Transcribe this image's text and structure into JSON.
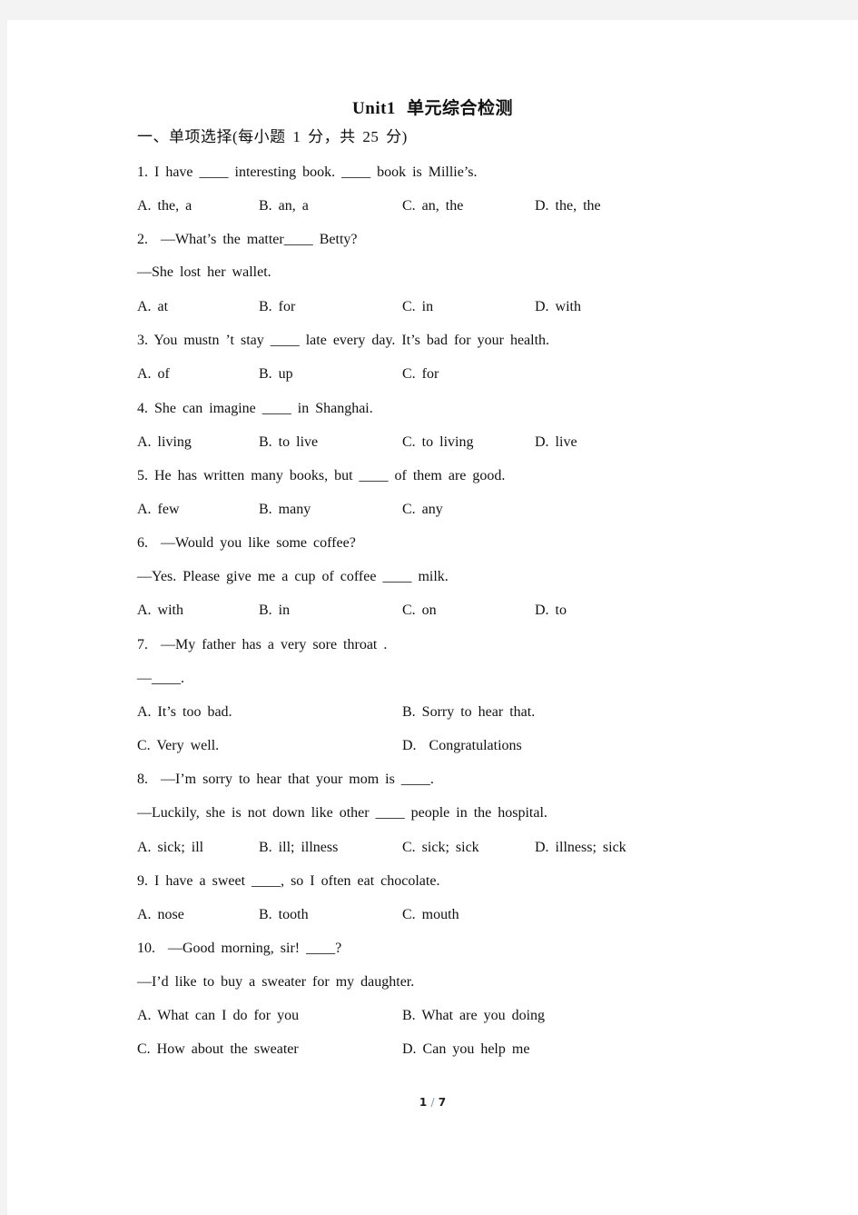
{
  "document": {
    "title_en": "Unit1",
    "title_cn": "单元综合检测",
    "section_heading": "一、单项选择(每小题 1 分，共 25 分)",
    "questions": [
      {
        "lines": [
          "1. I have ____ interesting book. ____ book is Millie’s."
        ],
        "options": [
          "A. the, a",
          "B. an, a",
          "C. an, the",
          "D. the, the"
        ]
      },
      {
        "lines": [
          "2.  —What’s the matter____ Betty?",
          "—She lost her wallet."
        ],
        "options": [
          "A. at",
          "B. for",
          "C. in",
          "D. with"
        ]
      },
      {
        "lines": [
          "3. You mustn ’t stay ____ late every day. It’s bad for your health."
        ],
        "options": [
          "A. of",
          "B. up",
          "C. for"
        ]
      },
      {
        "lines": [
          "4. She can imagine ____ in Shanghai."
        ],
        "options": [
          "A. living",
          "B. to live",
          "C. to living",
          "D. live"
        ]
      },
      {
        "lines": [
          "5. He has written many books, but ____ of them are good."
        ],
        "options": [
          "A. few",
          "B. many",
          "C. any"
        ]
      },
      {
        "lines": [
          "6.  —Would you like some coffee?",
          "—Yes. Please give me a cup of coffee ____ milk."
        ],
        "options": [
          "A. with",
          "B. in",
          "C. on",
          "D. to"
        ]
      },
      {
        "lines": [
          "7.  —My father has a very sore throat .",
          "—____."
        ],
        "options": [
          "A. It’s too bad.",
          "B. Sorry to hear that.",
          "C. Very well.",
          "D.  Congratulations"
        ]
      },
      {
        "lines": [
          "8.  —I’m sorry to hear that your mom is ____.",
          "—Luckily, she is not down like other ____ people in the hospital."
        ],
        "options": [
          "A. sick; ill",
          "B. ill; illness",
          "C. sick; sick",
          "D. illness; sick"
        ]
      },
      {
        "lines": [
          "9. I have a sweet ____, so I often eat chocolate."
        ],
        "options": [
          "A. nose",
          "B. tooth",
          "C. mouth"
        ]
      },
      {
        "lines": [
          "10.  —Good morning, sir! ____?",
          "—I’d like to buy a sweater for my daughter."
        ],
        "options": [
          "A. What can I do for you",
          "B. What are you doing",
          "C. How about the sweater",
          "D. Can you help me"
        ]
      }
    ]
  },
  "footer": {
    "current_page": "1",
    "separator": "/",
    "total_pages": "7"
  }
}
